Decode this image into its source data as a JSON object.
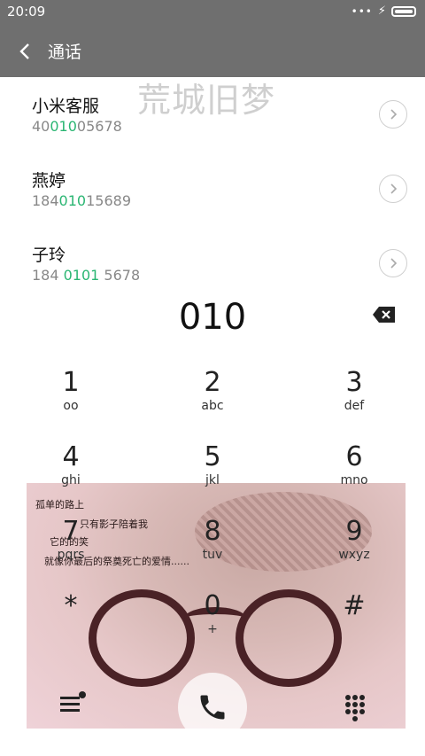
{
  "status": {
    "time": "20:09"
  },
  "header": {
    "title": "通话"
  },
  "watermark": "荒城旧梦",
  "contacts": [
    {
      "name": "小米客服",
      "number_prefix": "40",
      "number_match": "010",
      "number_suffix": "05678"
    },
    {
      "name": "燕婷",
      "number_prefix": "184",
      "number_match": "010",
      "number_suffix": "15689"
    },
    {
      "name": "子玲",
      "number_prefix": "184 ",
      "number_match": "0101",
      "number_suffix": " 5678"
    }
  ],
  "dialer": {
    "input": "010"
  },
  "keypad": [
    {
      "digit": "1",
      "letters": "ᴏᴏ"
    },
    {
      "digit": "2",
      "letters": "abc"
    },
    {
      "digit": "3",
      "letters": "def"
    },
    {
      "digit": "4",
      "letters": "ghi"
    },
    {
      "digit": "5",
      "letters": "jkl"
    },
    {
      "digit": "6",
      "letters": "mno"
    },
    {
      "digit": "7",
      "letters": "pqrs"
    },
    {
      "digit": "8",
      "letters": "tuv"
    },
    {
      "digit": "9",
      "letters": "wxyz"
    },
    {
      "digit": "*",
      "letters": ""
    },
    {
      "digit": "0",
      "letters": "+"
    },
    {
      "digit": "#",
      "letters": ""
    }
  ],
  "wallpaper_text": {
    "line1": "孤单的路上",
    "line2": "只有影子陪着我",
    "line3": "它的的笑",
    "line4": "就像你最后的祭奠死亡的爱情......"
  },
  "icons": {
    "back": "chevron-left-icon",
    "detail": "chevron-right-icon",
    "backspace": "backspace-icon",
    "menu": "menu-icon",
    "call": "phone-icon",
    "dialpad": "dialpad-icon"
  },
  "colors": {
    "bar": "#6f6f6f",
    "match_highlight": "#2bb673"
  }
}
